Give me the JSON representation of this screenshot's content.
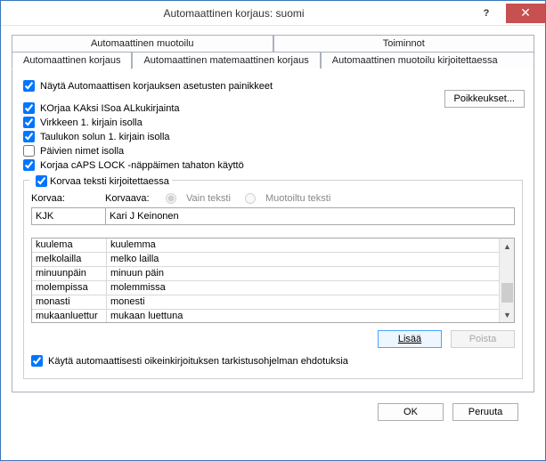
{
  "window": {
    "title": "Automaattinen korjaus: suomi"
  },
  "tabs": {
    "row1": [
      {
        "label": "Automaattinen muotoilu"
      },
      {
        "label": "Toiminnot"
      }
    ],
    "row2": [
      {
        "label": "Automaattinen korjaus",
        "active": true
      },
      {
        "label": "Automaattinen matemaattinen korjaus"
      },
      {
        "label": "Automaattinen muotoilu kirjoitettaessa"
      }
    ]
  },
  "checks": {
    "show_buttons": "Näytä Automaattisen korjauksen asetusten painikkeet",
    "two_initial_caps": "KOrjaa KAksi ISoa ALkukirjainta",
    "sentence_cap": "Virkkeen 1. kirjain isolla",
    "table_cell_cap": "Taulukon solun 1. kirjain isolla",
    "day_names": "Päivien nimet isolla",
    "caps_lock": "Korjaa cAPS LOCK -näppäimen tahaton käyttö"
  },
  "exceptions": {
    "label": "Poikkeukset..."
  },
  "replace": {
    "group_label": "Korvaa teksti kirjoitettaessa",
    "replace_label": "Korvaa:",
    "with_label": "Korvaava:",
    "plain_text": "Vain teksti",
    "formatted_text": "Muotoiltu teksti",
    "input_replace": "KJK",
    "input_with": "Kari J Keinonen"
  },
  "entries": [
    {
      "k": "kuulema",
      "v": "kuulemma"
    },
    {
      "k": "melkolailla",
      "v": "melko lailla"
    },
    {
      "k": "minuunpäin",
      "v": "minuun päin"
    },
    {
      "k": "molempissa",
      "v": "molemmissa"
    },
    {
      "k": "monasti",
      "v": "monesti"
    },
    {
      "k": "mukaanluettur",
      "v": "mukaan luettuna"
    }
  ],
  "tbl_buttons": {
    "add": "Lisää",
    "delete": "Poista"
  },
  "suggest": {
    "label": "Käytä automaattisesti oikeinkirjoituksen tarkistusohjelman ehdotuksia"
  },
  "footer": {
    "ok": "OK",
    "cancel": "Peruuta"
  }
}
